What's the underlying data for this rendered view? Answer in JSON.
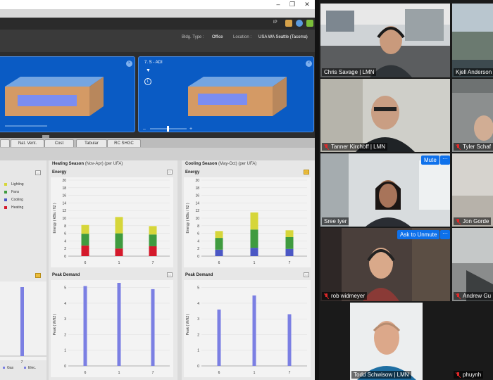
{
  "app": {
    "info": {
      "bldg_type_label": "Bldg. Type :",
      "bldg_type_value": "Office",
      "location_label": "Location :",
      "location_value": "USA WA Seattle (Tacoma)",
      "ip_label": "IP"
    },
    "views": [
      {
        "label": ""
      },
      {
        "label": "7. S - ADI"
      }
    ],
    "tabs": [
      "Nat. Vent.",
      "Cost",
      "Tabular",
      "RC SHGC"
    ],
    "legend": [
      "Lighting",
      "Fans",
      "Cooling",
      "Heating"
    ],
    "legend_colors": {
      "Lighting": "#d6d63a",
      "Fans": "#3f9b3f",
      "Cooling": "#4b57c4",
      "Heating": "#d4192b"
    },
    "left_bottom_labels": [
      "Gas",
      "Elec."
    ],
    "heating": {
      "title": "Heating Season",
      "subtitle": "(Nov-Apr) (per UFA)"
    },
    "cooling": {
      "title": "Cooling Season",
      "subtitle": "(May-Oct) (per UFA)"
    }
  },
  "chart_data": [
    {
      "type": "bar",
      "title": "Energy",
      "ylabel": "Energy ( kBtu / ft2 )",
      "ylim": [
        0,
        20
      ],
      "yticks": [
        0,
        2,
        4,
        6,
        8,
        10,
        12,
        14,
        16,
        18,
        20
      ],
      "categories": [
        "6",
        "1",
        "7"
      ],
      "series": [
        {
          "name": "Heating",
          "color": "#d4192b",
          "values": [
            2.8,
            2.0,
            2.6
          ]
        },
        {
          "name": "Fans",
          "color": "#3f9b3f",
          "values": [
            3.1,
            4.0,
            3.1
          ]
        },
        {
          "name": "Lighting",
          "color": "#d6d63a",
          "values": [
            2.3,
            4.3,
            2.2
          ]
        }
      ]
    },
    {
      "type": "bar",
      "title": "Energy",
      "ylabel": "Energy ( kBtu / ft2 )",
      "ylim": [
        0,
        20
      ],
      "yticks": [
        0,
        2,
        4,
        6,
        8,
        10,
        12,
        14,
        16,
        18,
        20
      ],
      "categories": [
        "6",
        "1",
        "7"
      ],
      "series": [
        {
          "name": "Cooling",
          "color": "#4b57c4",
          "values": [
            1.7,
            2.2,
            1.9
          ]
        },
        {
          "name": "Fans",
          "color": "#3f9b3f",
          "values": [
            3.1,
            4.8,
            3.1
          ]
        },
        {
          "name": "Lighting",
          "color": "#d6d63a",
          "values": [
            1.8,
            4.5,
            1.8
          ]
        }
      ]
    },
    {
      "type": "bar",
      "title": "Peak Demand",
      "ylabel": "Peak ( W/ft2 )",
      "ylim": [
        0,
        5.3
      ],
      "yticks": [
        0,
        1,
        2,
        3,
        4,
        5
      ],
      "categories": [
        "6",
        "1",
        "7"
      ],
      "series": [
        {
          "name": "Peak",
          "color": "#7b7fe3",
          "values": [
            5.1,
            5.3,
            4.9
          ]
        }
      ]
    },
    {
      "type": "bar",
      "title": "Peak Demand",
      "ylabel": "Peak ( W/ft2 )",
      "ylim": [
        0,
        5.3
      ],
      "yticks": [
        0,
        1,
        2,
        3,
        4,
        5
      ],
      "categories": [
        "6",
        "1",
        "7"
      ],
      "series": [
        {
          "name": "Peak",
          "color": "#7b7fe3",
          "values": [
            3.6,
            4.5,
            3.3
          ]
        }
      ]
    }
  ],
  "left_partial_chart": {
    "categories": [
      "7"
    ],
    "peak_values": [
      5.0
    ]
  },
  "gallery": {
    "participants": [
      {
        "name": "Chris Savage | LMN",
        "muted": false
      },
      {
        "name": "Kjell Anderson",
        "muted": false
      },
      {
        "name": "Tanner Kirchoff | LMN",
        "muted": true
      },
      {
        "name": "Tyler Schaf",
        "muted": true
      },
      {
        "name": "Sree Iyer",
        "muted": false
      },
      {
        "name": "Jon Gorde",
        "muted": true
      },
      {
        "name": "rob widmeyer",
        "muted": true
      },
      {
        "name": "Andrew Gu",
        "muted": true
      },
      {
        "name": "Todd Schwisow | LMN",
        "muted": false
      },
      {
        "name": "phuynh",
        "muted": true
      }
    ],
    "mute_button": "Mute",
    "ask_unmute_button": "Ask to Unmute",
    "more_button": "···"
  }
}
